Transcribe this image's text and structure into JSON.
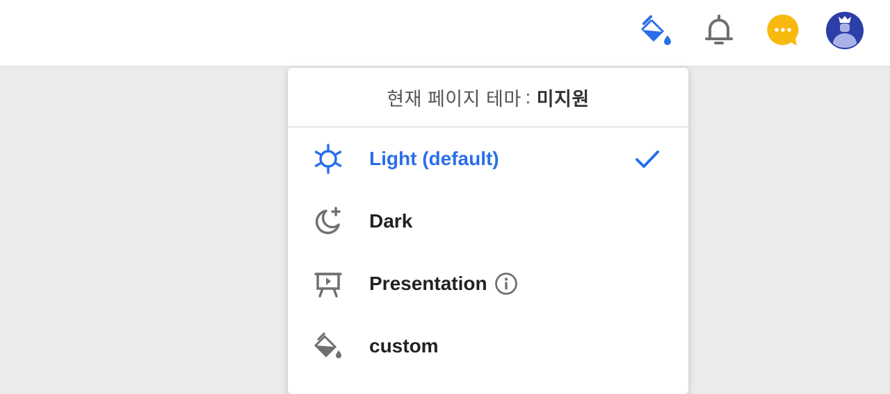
{
  "colors": {
    "accent": "#2a6fe8",
    "icon_gray": "#707070",
    "chat_yellow": "#f8b90f",
    "avatar_blue": "#2c3ea8"
  },
  "topbar": {
    "icons": [
      "paint-bucket-icon",
      "bell-icon",
      "chat-icon",
      "avatar"
    ]
  },
  "theme_menu": {
    "header_prefix": "현재 페이지 테마",
    "header_separator": ":",
    "current_theme": "미지원",
    "items": [
      {
        "label": "Light (default)",
        "icon": "sun-icon",
        "selected": true
      },
      {
        "label": "Dark",
        "icon": "moon-icon",
        "selected": false
      },
      {
        "label": "Presentation",
        "icon": "presentation-icon",
        "selected": false
      },
      {
        "label": "custom",
        "icon": "paint-bucket-icon",
        "selected": false
      }
    ]
  }
}
